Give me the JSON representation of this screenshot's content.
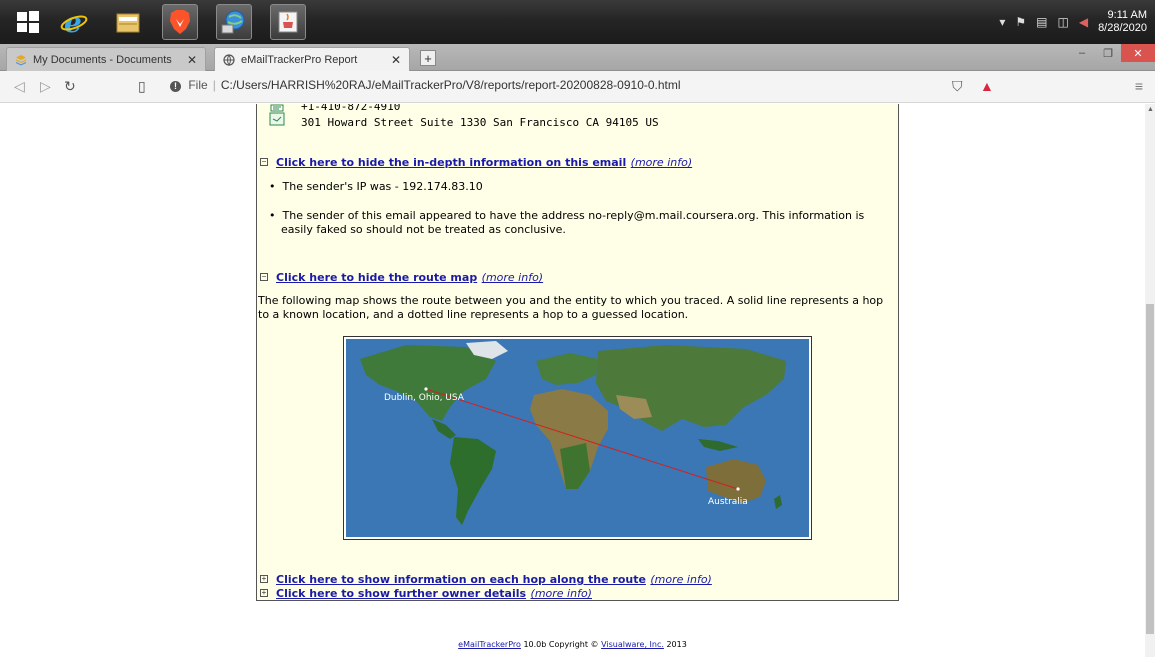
{
  "taskbar": {
    "apps": [
      "internet-explorer",
      "file-explorer",
      "brave-browser",
      "network-app",
      "java-app"
    ],
    "clock": {
      "time": "9:11 AM",
      "date": "8/28/2020"
    }
  },
  "tabs": [
    {
      "title": "My Documents - Documents"
    },
    {
      "title": "eMailTrackerPro Report"
    }
  ],
  "address": {
    "scheme_label": "File",
    "url": "C:/Users/HARRISH%20RAJ/eMailTrackerPro/V8/reports/report-20200828-0910-0.html"
  },
  "report": {
    "phone": "+1-410-872-4910",
    "address": "301 Howard Street Suite 1330 San Francisco CA 94105 US",
    "indepth_link": "Click here to hide the in-depth information on this email",
    "more_info": "(more info)",
    "bullet_ip": "The sender's IP was - 192.174.83.10",
    "bullet_sender_1": "The sender of this email appeared to have the address no-reply@m.mail.coursera.org. This information is",
    "bullet_sender_2": "easily faked so should not be treated as conclusive.",
    "routemap_link": "Click here to hide the route map",
    "route_text_1": "The following map shows the route between you and the entity to which you traced. A solid line represents a hop",
    "route_text_2": "to a known location, and a dotted line represents a hop to a guessed location.",
    "map_label_from": "Dublin, Ohio, USA",
    "map_label_to": "Australia",
    "hop_link": "Click here to show information on each hop along the route",
    "owner_link": "Click here to show further owner details"
  },
  "footer": {
    "product_link": "eMailTrackerPro",
    "text": "10.0b Copyright ©",
    "company_link": "Visualware, Inc.",
    "year": "2013"
  }
}
